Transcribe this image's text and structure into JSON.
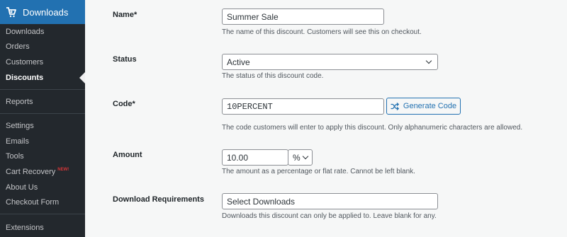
{
  "sidebar": {
    "menu_title": "Downloads",
    "items": [
      {
        "label": "Downloads"
      },
      {
        "label": "Orders"
      },
      {
        "label": "Customers"
      },
      {
        "label": "Discounts"
      },
      {
        "label": "Reports"
      },
      {
        "label": "Settings"
      },
      {
        "label": "Emails"
      },
      {
        "label": "Tools"
      },
      {
        "label": "Cart Recovery",
        "badge": "NEW!"
      },
      {
        "label": "About Us"
      },
      {
        "label": "Checkout Form"
      },
      {
        "label": "Extensions"
      }
    ],
    "current": "Discounts",
    "colors": {
      "bg": "#23282d",
      "accent": "#2271b1",
      "badge": "#d63638"
    }
  },
  "form": {
    "name": {
      "label": "Name*",
      "value": "Summer Sale",
      "desc": "The name of this discount. Customers will see this on checkout."
    },
    "status": {
      "label": "Status",
      "value": "Active",
      "desc": "The status of this discount code."
    },
    "code": {
      "label": "Code*",
      "value": "10PERCENT",
      "button": "Generate Code",
      "desc": "The code customers will enter to apply this discount. Only alphanumeric characters are allowed."
    },
    "amount": {
      "label": "Amount",
      "value": "10.00",
      "unit": "%",
      "desc": "The amount as a percentage or flat rate. Cannot be left blank."
    },
    "downloads": {
      "label": "Download Requirements",
      "placeholder": "Select Downloads",
      "desc": "Downloads this discount can only be applied to. Leave blank for any."
    }
  }
}
